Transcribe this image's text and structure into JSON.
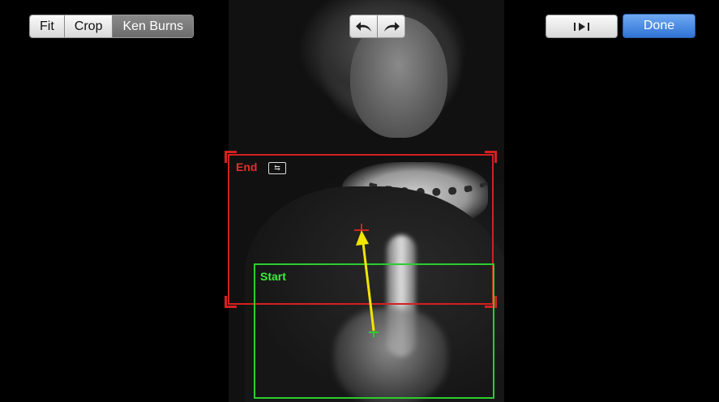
{
  "toolbar": {
    "modes": [
      {
        "label": "Fit",
        "selected": false
      },
      {
        "label": "Crop",
        "selected": false
      },
      {
        "label": "Ken Burns",
        "selected": true
      }
    ],
    "done_label": "Done"
  },
  "ken_burns": {
    "end_label": "End",
    "start_label": "Start",
    "end_color": "#d42020",
    "start_color": "#2ecc2e",
    "arrow_color": "#f2e600"
  }
}
